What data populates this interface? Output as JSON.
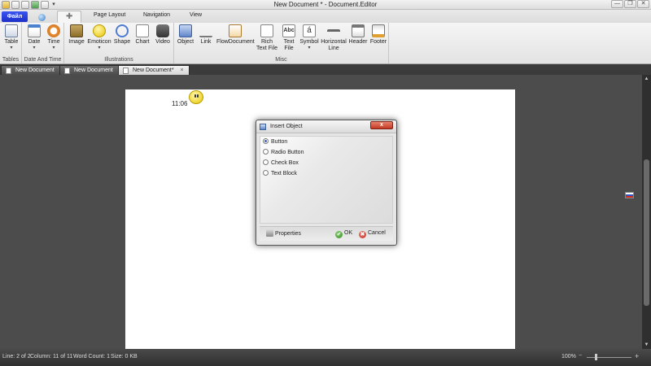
{
  "window": {
    "title": "New Document * - Document.Editor",
    "minimize": "—",
    "restore": "❐",
    "close": "✕",
    "qat_caret": "▾"
  },
  "ribbon_tabs": {
    "file": "Файл",
    "page_layout": "Page Layout",
    "navigation": "Navigation",
    "view": "View"
  },
  "ribbon": {
    "tables": {
      "label": "Tables",
      "table": "Table"
    },
    "date_time": {
      "label": "Date And Time",
      "date": "Date",
      "time": "Time"
    },
    "illustrations": {
      "label": "Illustrations",
      "image": "Image",
      "emoticon": "Emoticon",
      "shape": "Shape",
      "chart": "Chart",
      "video": "Video"
    },
    "misc": {
      "label": "Misc",
      "object": "Object",
      "link": "Link",
      "flowdocument": "FlowDocument",
      "rich_text_file": "Rich Text File",
      "text_file": "Text File",
      "symbol": "Symbol",
      "symbol_glyph": "á",
      "text_file_glyph": "Abc",
      "horizontal_line": "Horizontal Line",
      "header": "Header",
      "footer": "Footer"
    },
    "dropdown_arrow": "▾"
  },
  "doc_tabs": [
    {
      "label": "New Document"
    },
    {
      "label": "New Document"
    },
    {
      "label": "New Document*",
      "close": "×"
    }
  ],
  "document": {
    "time_text": "11:06"
  },
  "dialog": {
    "title": "Insert Object",
    "close": "x",
    "options": [
      {
        "label": "Button",
        "checked": true
      },
      {
        "label": "Radio Button",
        "checked": false
      },
      {
        "label": "Check Box",
        "checked": false
      },
      {
        "label": "Text Block",
        "checked": false
      }
    ],
    "properties": "Properties",
    "ok": "OK",
    "cancel": "Cancel",
    "ok_glyph": "✔",
    "cancel_glyph": "✖"
  },
  "status": {
    "line": "Line: 2 of 2",
    "column": "Column: 11 of 11",
    "word_count": "Word Count: 1",
    "size": "Size: 0 KB",
    "zoom": "100%",
    "zoom_minus": "−",
    "zoom_plus": "+",
    "zoom_level": 1.0
  },
  "scroll": {
    "up": "▲",
    "down": "▼"
  },
  "colors": {
    "file_tab": "#2a3fe0",
    "dialog_close": "#c23a24",
    "background": "#4d4d4d"
  }
}
